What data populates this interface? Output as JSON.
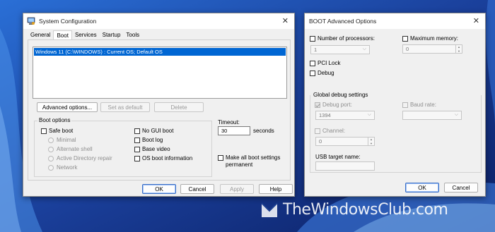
{
  "watermark": "TheWindowsClub.com",
  "sysconfig": {
    "title": "System Configuration",
    "tabs": [
      "General",
      "Boot",
      "Services",
      "Startup",
      "Tools"
    ],
    "boot_entry": "Windows 11 (C:\\WINDOWS) : Current OS; Default OS",
    "advanced_options": "Advanced options...",
    "set_default": "Set as default",
    "delete": "Delete",
    "boot_options_label": "Boot options",
    "safe_boot": "Safe boot",
    "minimal": "Minimal",
    "alternate_shell": "Alternate shell",
    "ad_repair": "Active Directory repair",
    "network": "Network",
    "no_gui_boot": "No GUI boot",
    "boot_log": "Boot log",
    "base_video": "Base video",
    "os_boot_info": "OS boot information",
    "timeout_label": "Timeout:",
    "timeout_value": "30",
    "seconds": "seconds",
    "make_permanent": "Make all boot settings permanent",
    "ok": "OK",
    "cancel": "Cancel",
    "apply": "Apply",
    "help": "Help"
  },
  "advanced": {
    "title": "BOOT Advanced Options",
    "num_processors": "Number of processors:",
    "processors_value": "1",
    "max_memory": "Maximum memory:",
    "memory_value": "0",
    "pci_lock": "PCI Lock",
    "debug": "Debug",
    "global_debug": "Global debug settings",
    "debug_port": "Debug port:",
    "debug_port_value": "1394",
    "baud_rate": "Baud rate:",
    "channel": "Channel:",
    "channel_value": "0",
    "usb_target": "USB target name:",
    "ok": "OK",
    "cancel": "Cancel"
  },
  "colors": {
    "accent": "#0066d3",
    "wallpaper": "#1b3e8f"
  }
}
